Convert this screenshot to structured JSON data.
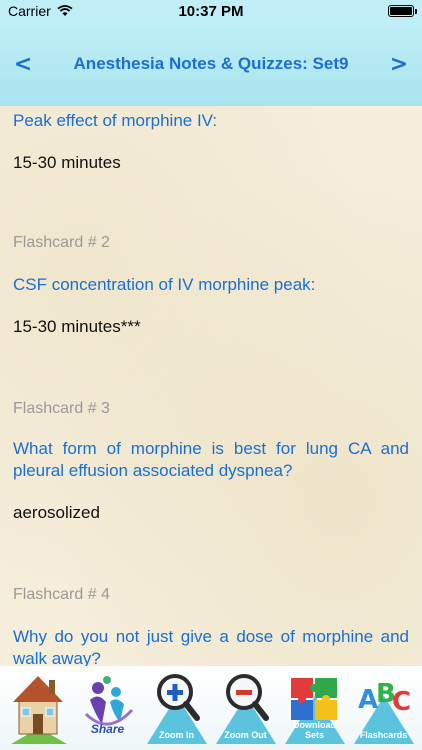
{
  "status_bar": {
    "carrier": "Carrier",
    "time": "10:37 PM",
    "battery_level": 1.0
  },
  "nav": {
    "back_label": "<",
    "title": "Anesthesia Notes & Quizzes: Set9",
    "forward_label": ">"
  },
  "cards": [
    {
      "label": "",
      "question": "Peak effect of morphine IV:",
      "answer": "15-30 minutes"
    },
    {
      "label": "Flashcard # 2",
      "question": "CSF concentration of IV morphine peak:",
      "answer": "15-30 minutes***"
    },
    {
      "label": "Flashcard # 3",
      "question": "What form of morphine is best for lung CA and pleural effusion associated dyspnea?",
      "answer": "aerosolized"
    },
    {
      "label": "Flashcard # 4",
      "question": "Why do you not just give a dose of morphine and walk away?",
      "answer": ""
    }
  ],
  "toolbar": {
    "home_icon": "house-icon",
    "share_label": "Share",
    "zoom_in_label": "Zoom In",
    "zoom_out_label": "Zoom Out",
    "puzzle_label": "Download Sets",
    "abc_label": "Flashcards"
  },
  "colors": {
    "accent": "#1a6fd0",
    "nav_bg": "#bfeef6",
    "label_gray": "#9a9a9a",
    "toolbar_triangle": "#5cc3df"
  }
}
